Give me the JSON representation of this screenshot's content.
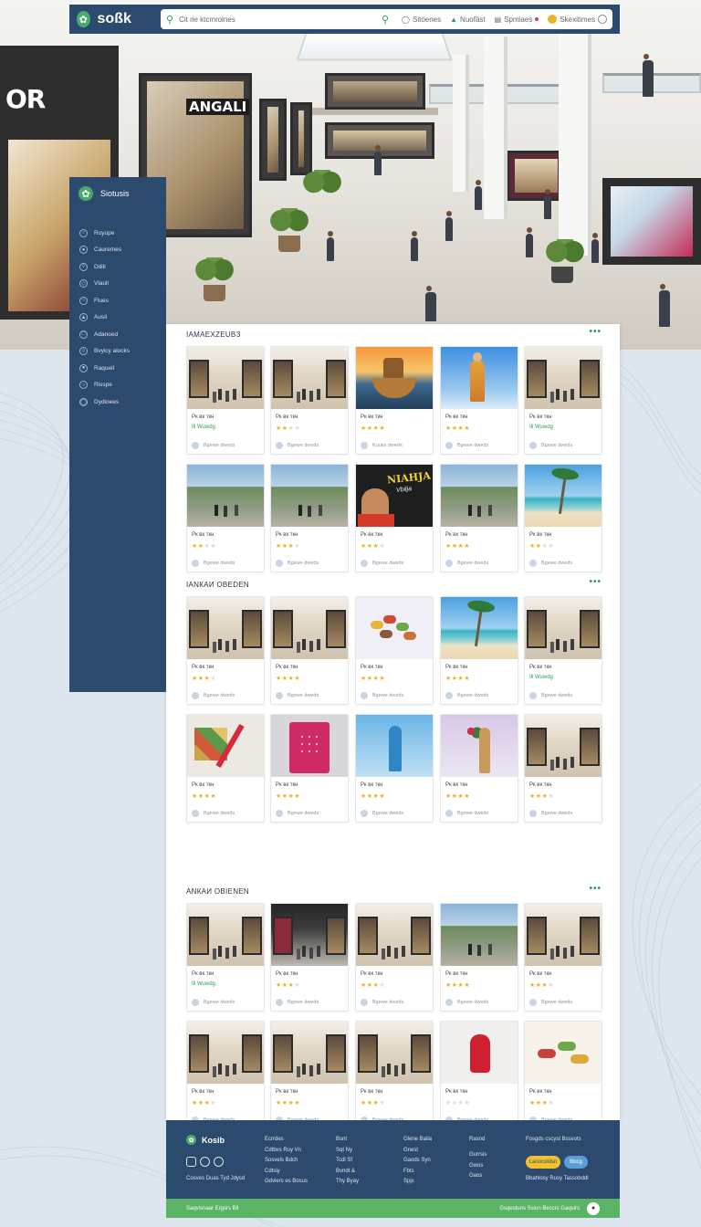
{
  "header": {
    "brand": "soßk",
    "search_placeholder": "Cit rie ktcmrolnes",
    "nav": [
      {
        "label": "Sitöenes",
        "icon": "user-icon"
      },
      {
        "label": "Nuofäst",
        "icon": "tag-icon"
      },
      {
        "label": "Spmiaes",
        "icon": "cart-icon"
      },
      {
        "label": "Skexitimes",
        "icon": "avatar-icon"
      }
    ]
  },
  "sidebar": {
    "title": "Siotusis",
    "items": [
      "Ruyupe",
      "Cauremes",
      "Ddill",
      "Vlaull",
      "Flues",
      "Ausil",
      "Adanoed",
      "Bvyicy alocks",
      "Raqueil",
      "Risspe",
      "Dydioees"
    ]
  },
  "sections": [
    {
      "title": "ІАМАЕХZЕUBЗ",
      "cards": [
        {
          "title": "Рк вк ткн",
          "rating": "green",
          "rating_text": "Ili Wuwdg",
          "meta": "Bgewe dweds",
          "thumb": "mall"
        },
        {
          "title": "Рк вк ткн",
          "rating": "2",
          "meta": "Bgewe dweds",
          "thumb": "mall"
        },
        {
          "title": "Рк вк ткн",
          "rating": "4",
          "meta": "Kuuks dweds",
          "thumb": "sunset"
        },
        {
          "title": "Рк вк ткн",
          "rating": "4",
          "meta": "Bgewe dweds",
          "thumb": "sky"
        },
        {
          "title": "Рк вк ткн",
          "rating": "green",
          "rating_text": "Ili Wuwdg",
          "meta": "Bgewe dweds",
          "thumb": "mall"
        },
        {
          "title": "Рк вк ткн",
          "rating": "2",
          "meta": "Bgewe dweds",
          "thumb": "street"
        },
        {
          "title": "Рк вк ткн",
          "rating": "3",
          "meta": "Bgewe dweds",
          "thumb": "street"
        },
        {
          "title": "Рк вк ткн",
          "rating": "3",
          "meta": "Bgewe dweds",
          "thumb": "poster"
        },
        {
          "title": "Рк вк ткн",
          "rating": "4",
          "meta": "Bgewe dweds",
          "thumb": "street"
        },
        {
          "title": "Рк вк ткн",
          "rating": "2",
          "meta": "Bgewe dweds",
          "thumb": "beach"
        }
      ]
    },
    {
      "title": "ІАNКАИ ОВЕDЕN",
      "cards": [
        {
          "title": "Рк вк ткн",
          "rating": "3",
          "meta": "Bgewe dweds",
          "thumb": "mall"
        },
        {
          "title": "Рк вк ткн",
          "rating": "4",
          "meta": "Bgewe dweds",
          "thumb": "mall"
        },
        {
          "title": "Рк вк ткн",
          "rating": "4",
          "meta": "Bgewe dweds",
          "thumb": "food"
        },
        {
          "title": "Рк вк ткн",
          "rating": "4",
          "meta": "Bgewe dweds",
          "thumb": "beach"
        },
        {
          "title": "Рк вк ткн",
          "rating": "green",
          "rating_text": "Ili Wuwdg",
          "meta": "Bgewe dweds",
          "thumb": "mall"
        },
        {
          "title": "Рк вк ткн",
          "rating": "4",
          "meta": "Bgewe dweds",
          "thumb": "craft"
        },
        {
          "title": "Рк вк ткн",
          "rating": "4",
          "meta": "Bgewe dweds",
          "thumb": "pinkbag"
        },
        {
          "title": "Рк вк ткн",
          "rating": "4",
          "meta": "Bgewe dweds",
          "thumb": "blue2"
        },
        {
          "title": "Рк вк ткн",
          "rating": "4",
          "meta": "Bgewe dweds",
          "thumb": "lilac"
        },
        {
          "title": "Рк вк ткн",
          "rating": "3",
          "meta": "Bgewe dweds",
          "thumb": "mall"
        }
      ]
    },
    {
      "title": "АNКАИ ОВIЕNЕN",
      "cards": [
        {
          "title": "Рк вк ткн",
          "rating": "green",
          "rating_text": "Ili Wuwdg",
          "meta": "Bgewe dweds",
          "thumb": "mall"
        },
        {
          "title": "Рк вк ткн",
          "rating": "3",
          "meta": "Bgewe dweds",
          "thumb": "dark"
        },
        {
          "title": "Рк вк ткн",
          "rating": "3",
          "meta": "Bgewe dweds",
          "thumb": "mall"
        },
        {
          "title": "Рк вк ткн",
          "rating": "4",
          "meta": "Bgewe dweds",
          "thumb": "street"
        },
        {
          "title": "Рк вк ткн",
          "rating": "3",
          "meta": "Bgewe dweds",
          "thumb": "mall"
        },
        {
          "title": "Рк вк ткн",
          "rating": "3",
          "meta": "Bgewe dweds",
          "thumb": "mall"
        },
        {
          "title": "Рк вк ткн",
          "rating": "4",
          "meta": "Bgewe dweds",
          "thumb": "mall"
        },
        {
          "title": "Рк вк ткн",
          "rating": "3",
          "meta": "Bgewe dweds",
          "thumb": "mall"
        },
        {
          "title": "Рк вк ткн",
          "rating": "0",
          "meta": "Bgewe dweds",
          "thumb": "red"
        },
        {
          "title": "Рк вк ткн",
          "rating": "3",
          "meta": "Bgewe dweds",
          "thumb": "mixedfood"
        }
      ]
    }
  ],
  "section_more": "•••",
  "footer": {
    "brand": "Kosib",
    "note": "Cosves Duas Tyd Jdysd",
    "columns": [
      [
        "Ecrrdes",
        "Cdtbvs Ruy Vn",
        "Sosvels Bdch",
        "Cdtsiy",
        "Gdvlers es Bosus"
      ],
      [
        "Bsnt",
        "Sqt Ny",
        "Tcdl Sf",
        "Bvndt &",
        "Thy Byay"
      ],
      [
        "Glene Baila",
        "Gnest",
        "Gaods Syn",
        "Fbts",
        "Spjs"
      ],
      [
        "Rasnd",
        "",
        "Gurrsis",
        "Gwos",
        "Gaos"
      ]
    ],
    "cta_title": "Fosgds cscyst Bssvots",
    "cta_yellow": "Lanocoldsn",
    "cta_blue": "Bbcg",
    "cta_note": "Bbahlosy Rusy Tassobddl"
  },
  "bottom_bar": {
    "left": "Saqvisnaar Ergsrs Bil",
    "right": "Gsqestuns Ssiun Beccrs Gaqsirs"
  },
  "hero_sign_left": "OR",
  "hero_sign_store": "ANGALI"
}
